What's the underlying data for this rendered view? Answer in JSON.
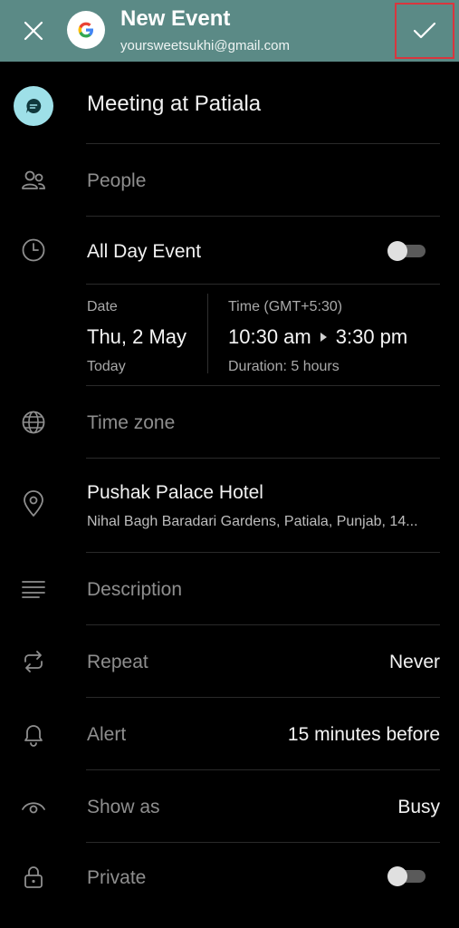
{
  "header": {
    "title": "New Event",
    "account_email": "yoursweetsukhi@gmail.com"
  },
  "event": {
    "title": "Meeting at Patiala",
    "people_placeholder": "People",
    "all_day_label": "All Day Event",
    "all_day_on": false,
    "date_label": "Date",
    "date_value": "Thu, 2 May",
    "date_relative": "Today",
    "time_label": "Time (GMT+5:30)",
    "start_time": "10:30 am",
    "end_time": "3:30 pm",
    "duration": "Duration: 5 hours",
    "timezone_placeholder": "Time zone",
    "location_name": "Pushak Palace Hotel",
    "location_address": "Nihal Bagh Baradari Gardens, Patiala, Punjab, 14...",
    "description_placeholder": "Description",
    "repeat_label": "Repeat",
    "repeat_value": "Never",
    "alert_label": "Alert",
    "alert_value": "15 minutes before",
    "show_as_label": "Show as",
    "show_as_value": "Busy",
    "private_label": "Private",
    "private_on": false
  },
  "colors": {
    "header_bg": "#5b8a86",
    "accent": "#9ee0e8",
    "highlight_border": "#d9363e"
  },
  "icons": [
    "close-icon",
    "google-logo-icon",
    "check-icon",
    "chat-bubble-icon",
    "people-icon",
    "clock-icon",
    "globe-icon",
    "location-pin-icon",
    "description-lines-icon",
    "repeat-icon",
    "bell-icon",
    "eye-icon",
    "lock-icon"
  ]
}
